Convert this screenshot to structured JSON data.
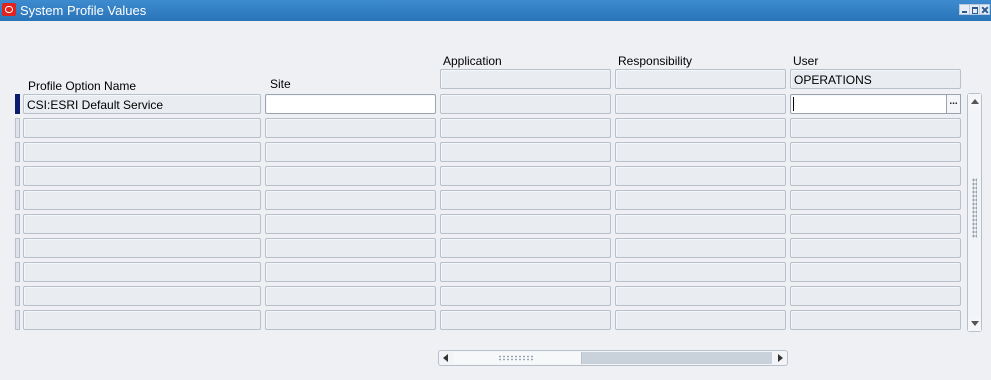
{
  "window": {
    "title": "System Profile Values"
  },
  "columns": {
    "profile_option_name": "Profile Option Name",
    "site": "Site",
    "application": "Application",
    "responsibility": "Responsibility",
    "user": "User"
  },
  "context": {
    "user_value": "OPERATIONS",
    "application_value": "",
    "responsibility_value": ""
  },
  "rows": [
    {
      "name": "CSI:ESRI Default Service",
      "site": "",
      "application": "",
      "responsibility": "",
      "user": ""
    },
    {
      "name": "",
      "site": "",
      "application": "",
      "responsibility": "",
      "user": ""
    },
    {
      "name": "",
      "site": "",
      "application": "",
      "responsibility": "",
      "user": ""
    },
    {
      "name": "",
      "site": "",
      "application": "",
      "responsibility": "",
      "user": ""
    },
    {
      "name": "",
      "site": "",
      "application": "",
      "responsibility": "",
      "user": ""
    },
    {
      "name": "",
      "site": "",
      "application": "",
      "responsibility": "",
      "user": ""
    },
    {
      "name": "",
      "site": "",
      "application": "",
      "responsibility": "",
      "user": ""
    },
    {
      "name": "",
      "site": "",
      "application": "",
      "responsibility": "",
      "user": ""
    },
    {
      "name": "",
      "site": "",
      "application": "",
      "responsibility": "",
      "user": ""
    },
    {
      "name": "",
      "site": "",
      "application": "",
      "responsibility": "",
      "user": ""
    }
  ],
  "lov_button": {
    "label": "..."
  },
  "icons": {
    "app": "oracle-logo-icon",
    "minimize": "minimize-icon",
    "maximize": "maximize-icon",
    "close": "close-icon"
  }
}
